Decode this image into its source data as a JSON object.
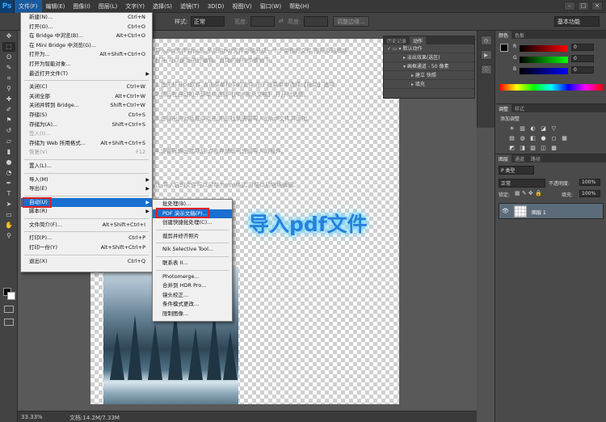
{
  "app": {
    "logo": "Ps"
  },
  "menubar": {
    "items": [
      "文件(F)",
      "编辑(E)",
      "图像(I)",
      "图层(L)",
      "文字(Y)",
      "选择(S)",
      "滤镜(T)",
      "3D(D)",
      "视图(V)",
      "窗口(W)",
      "帮助(H)"
    ],
    "window_controls": [
      "–",
      "□",
      "×"
    ]
  },
  "options_bar": {
    "style_label": "样式:",
    "style_value": "正常",
    "width_label": "宽度:",
    "height_label": "高度:",
    "refine_edge_button": "调整边缘...",
    "workspace": "基本功能"
  },
  "file_menu": {
    "items": [
      {
        "label": "新建(N)...",
        "shortcut": "Ctrl+N"
      },
      {
        "label": "打开(O)...",
        "shortcut": "Ctrl+O"
      },
      {
        "label": "在 Bridge 中浏览(B)...",
        "shortcut": "Alt+Ctrl+O"
      },
      {
        "label": "在 Mini Bridge 中浏览(G)...",
        "shortcut": ""
      },
      {
        "label": "打开为...",
        "shortcut": "Alt+Shift+Ctrl+O"
      },
      {
        "label": "打开为智能对象...",
        "shortcut": ""
      },
      {
        "label": "最近打开文件(T)",
        "shortcut": "",
        "submenu": true
      },
      {
        "sep": true
      },
      {
        "label": "关闭(C)",
        "shortcut": "Ctrl+W"
      },
      {
        "label": "关闭全部",
        "shortcut": "Alt+Ctrl+W"
      },
      {
        "label": "关闭并转到 Bridge...",
        "shortcut": "Shift+Ctrl+W"
      },
      {
        "label": "存储(S)",
        "shortcut": "Ctrl+S"
      },
      {
        "label": "存储为(A)...",
        "shortcut": "Shift+Ctrl+S"
      },
      {
        "label": "签入(I)...",
        "shortcut": "",
        "disabled": true
      },
      {
        "label": "存储为 Web 所用格式...",
        "shortcut": "Alt+Shift+Ctrl+S"
      },
      {
        "label": "恢复(V)",
        "shortcut": "F12",
        "disabled": true
      },
      {
        "sep": true
      },
      {
        "label": "置入(L)...",
        "shortcut": ""
      },
      {
        "sep": true
      },
      {
        "label": "导入(M)",
        "shortcut": "",
        "submenu": true
      },
      {
        "label": "导出(E)",
        "shortcut": "",
        "submenu": true
      },
      {
        "sep": true
      },
      {
        "label": "自动(U)",
        "shortcut": "",
        "submenu": true,
        "highlight": true
      },
      {
        "label": "脚本(R)",
        "shortcut": "",
        "submenu": true
      },
      {
        "sep": true
      },
      {
        "label": "文件简介(F)...",
        "shortcut": "Alt+Shift+Ctrl+I"
      },
      {
        "sep": true
      },
      {
        "label": "打印(P)...",
        "shortcut": "Ctrl+P"
      },
      {
        "label": "打印一份(Y)",
        "shortcut": "Alt+Shift+Ctrl+P"
      },
      {
        "sep": true
      },
      {
        "label": "退出(X)",
        "shortcut": "Ctrl+Q"
      }
    ]
  },
  "automate_submenu": {
    "items": [
      {
        "label": "批处理(B)..."
      },
      {
        "label": "PDF 演示文稿(P)...",
        "highlight": true
      },
      {
        "label": "创建快捷批处理(C)..."
      },
      {
        "sep": true
      },
      {
        "label": "裁剪并修齐照片"
      },
      {
        "sep": true
      },
      {
        "label": "Nik Selective Tool..."
      },
      {
        "sep": true
      },
      {
        "label": "联系表 II..."
      },
      {
        "sep": true
      },
      {
        "label": "Photomerge..."
      },
      {
        "label": "合并到 HDR Pro..."
      },
      {
        "label": "镜头校正..."
      },
      {
        "label": "条件模式更改..."
      },
      {
        "label": "限制图像..."
      }
    ]
  },
  "canvas": {
    "overlay_text": "导入pdf文件",
    "overlay_color": "#2a7fd8",
    "ghost_lines": [
      "导入pdf文件到ps后,多页的pdf文件会被分成一个个单独的文件,按照页码顺序",
      "打开,可以逐页进行编辑。具体的操作步骤如下。",
      "1.首先打开ps软件,点击菜单栏中的文件,在下拉菜单中选择【自动】选项",
      "2.然后在自动的子菜单中选择【PDF演示文稿】,打开对话框。",
      "3.在弹出的对话框中点击浏览,找到需要导入的pdf文件并添加。",
      "4.设置好输出选项后,点击存储即可完成导入的操作。",
      "注:导入后的文件可以另存为psd格式,方便以后继续编辑。"
    ]
  },
  "statusbar": {
    "zoom": "33.33%",
    "doc_size": "文档:14.2M/7.33M"
  },
  "actions_panel": {
    "tabs": [
      "历史记录",
      "动作"
    ],
    "rows": [
      "默认动作",
      "淡出效果(选区)",
      "画框通道 - 50 像素",
      "建立 快照",
      "填充"
    ]
  },
  "color_panel": {
    "tabs": [
      "颜色",
      "色板"
    ],
    "channels": [
      {
        "label": "R",
        "value": "0",
        "color": "#e04040"
      },
      {
        "label": "G",
        "value": "0",
        "color": "#40c040"
      },
      {
        "label": "B",
        "value": "0",
        "color": "#4060e0"
      }
    ]
  },
  "adjustments_panel": {
    "tabs": [
      "调整",
      "样式"
    ],
    "title": "添加调整",
    "row1": [
      "☀",
      "▥",
      "◐",
      "◪",
      "▽"
    ],
    "row2": [
      "▤",
      "◍",
      "◧",
      "●",
      "◻",
      "▦"
    ],
    "row3": [
      "◩",
      "◨",
      "▨",
      "◫",
      "▩"
    ]
  },
  "layers_panel": {
    "tabs": [
      "图层",
      "通道",
      "路径"
    ],
    "filter": "P 类型",
    "blend_mode": "正常",
    "opacity_label": "不透明度:",
    "opacity": "100%",
    "lock_label": "锁定:",
    "fill_label": "填充:",
    "fill": "100%",
    "layer_name": "图层 1"
  }
}
